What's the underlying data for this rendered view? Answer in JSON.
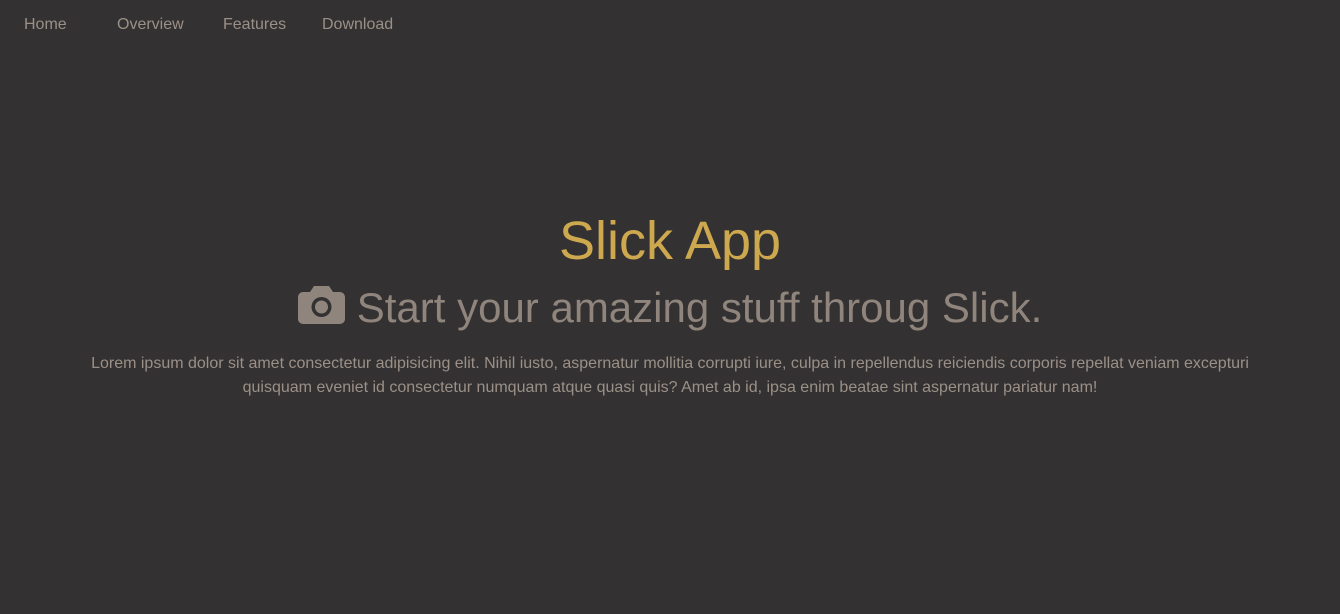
{
  "nav": {
    "home": "Home",
    "overview": "Overview",
    "features": "Features",
    "download": "Download"
  },
  "hero": {
    "title": "Slick App",
    "subtitle_icon": "camera-icon",
    "subtitle": "Start your amazing stuff throug Slick.",
    "body": "Lorem ipsum dolor sit amet consectetur adipisicing elit. Nihil iusto, aspernatur mollitia corrupti iure, culpa in repellendus reiciendis corporis repellat veniam excepturi quisquam eveniet id consectetur numquam atque quasi quis? Amet ab id, ipsa enim beatae sint aspernatur pariatur nam!"
  },
  "colors": {
    "background": "#333132",
    "accent": "#cda84e",
    "muted_text": "#9b9087"
  }
}
